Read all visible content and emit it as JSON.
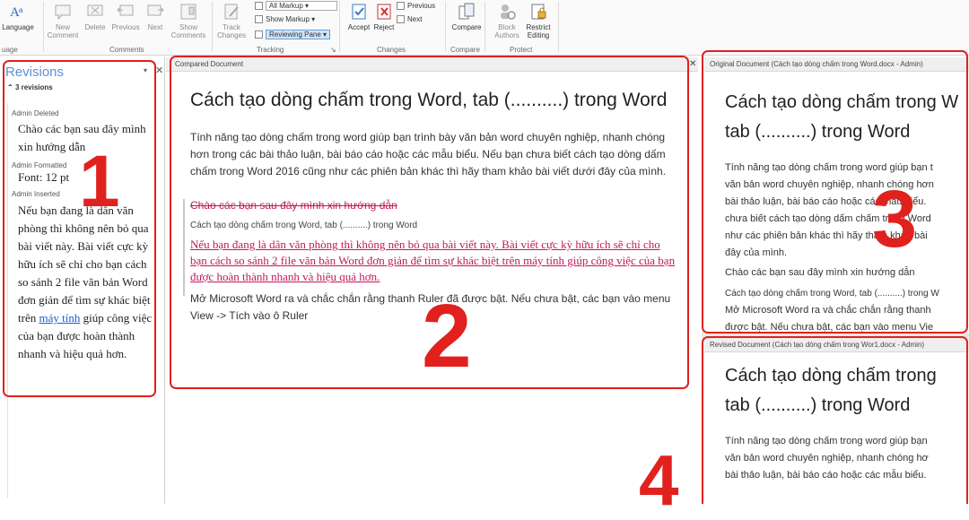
{
  "ribbon": {
    "language": "Language",
    "language_group": "uage",
    "new_comment": "New Comment",
    "delete": "Delete",
    "previous": "Previous",
    "next": "Next",
    "show_comments": "Show Comments",
    "comments_group": "Comments",
    "track_changes": "Track Changes",
    "all_markup": "All Markup",
    "show_markup": "Show Markup",
    "reviewing_pane": "Reviewing Pane",
    "tracking_group": "Tracking",
    "accept": "Accept",
    "reject": "Reject",
    "changes_previous": "Previous",
    "changes_next": "Next",
    "changes_group": "Changes",
    "compare": "Compare",
    "compare_group": "Compare",
    "block_authors": "Block Authors",
    "restrict_editing": "Restrict Editing",
    "protect_group": "Protect"
  },
  "revisions": {
    "title": "Revisions",
    "count": "3 revisions",
    "items": [
      {
        "author": "Admin Deleted",
        "text": "Chào các bạn sau đây mình xin hướng dẫn"
      },
      {
        "author": "Admin Formatted",
        "text": "Font: 12 pt"
      },
      {
        "author": "Admin Inserted",
        "text_a": "Nếu bạn đang là dân văn phòng thì không nên bỏ qua bài viết này. Bài viết cực kỳ hữu ích sẽ chỉ cho bạn cách so sánh 2 file văn bản Word đơn giản để tìm sự khác biệt trên",
        "link": "máy tính",
        "text_b": "giúp công việc của bạn được hoàn thành nhanh và hiệu quả hơn."
      }
    ]
  },
  "compared": {
    "header": "Compared Document",
    "title": "Cách tạo dòng chấm trong Word, tab (..........) trong Word",
    "intro": "Tính năng tạo dòng chấm trong word giúp bạn trình bày văn bản word chuyên nghiệp, nhanh chóng hơn trong các bài thảo luận, bài báo cáo hoặc các mẫu biểu. Nếu bạn chưa biết cách tạo dòng dấm chấm trong Word 2016 cũng như các phiên bản khác thì hãy tham khảo bài viết dưới đây của mình.",
    "deleted": "Chào các bạn sau đây mình xin hướng dẫn",
    "subline": "Cách tạo dòng chấm trong Word, tab (..........) trong Word",
    "inserted": "Nếu bạn đang là dân văn phòng thì không nên bỏ qua bài viết này. Bài viết cực kỳ hữu ích sẽ chỉ cho bạn cách so sánh 2 file văn bản Word đơn giản để tìm sự khác biệt trên máy tính giúp công việc của bạn được hoàn thành nhanh và hiệu quả hơn.",
    "last": "Mở Microsoft Word ra và chắc chắn rằng thanh Ruler đã được bật. Nếu chưa bật, các bạn vào menu View -> Tích vào ô Ruler"
  },
  "original": {
    "header": "Original Document (Cách tạo dòng chấm trong Word.docx - Admin)",
    "title_1": "Cách tạo dòng chấm trong W",
    "title_2": "tab (..........) trong Word",
    "lines": [
      "Tính năng tạo dòng chấm trong word giúp bạn t",
      "văn bản word chuyên nghiệp, nhanh chóng hơn",
      "bài thảo luận, bài báo cáo hoặc các mẫu biểu.",
      "chưa biết cách tạo dòng dấm chấm trong Word",
      "như các phiên bản khác thì hãy tham khảo bài",
      "đây của mình.",
      "Chào các bạn sau đây mình xin hướng dẫn",
      "Cách tạo dòng chấm trong Word, tab (..........) trong W",
      "Mở Microsoft Word ra và chắc chắn rằng thanh",
      "được bật. Nếu chưa bật, các bạn vào menu Vie"
    ]
  },
  "revised": {
    "header": "Revised Document (Cách tạo dòng chấm trong Wor1.docx - Admin)",
    "title_1": "Cách tạo dòng chấm trong",
    "title_2": "tab (..........) trong Word",
    "lines": [
      "Tính năng tạo dòng chấm trong word giúp bạn",
      "văn bản word chuyên nghiệp, nhanh chóng hơ",
      "bài thảo luận, bài báo cáo hoặc các mẫu biểu."
    ]
  },
  "annotations": {
    "n1": "1",
    "n2": "2",
    "n3": "3",
    "n4": "4"
  },
  "colors": {
    "accent": "#e0211e",
    "revision_text": "#c2185b",
    "pane_title": "#5a8fd6"
  }
}
